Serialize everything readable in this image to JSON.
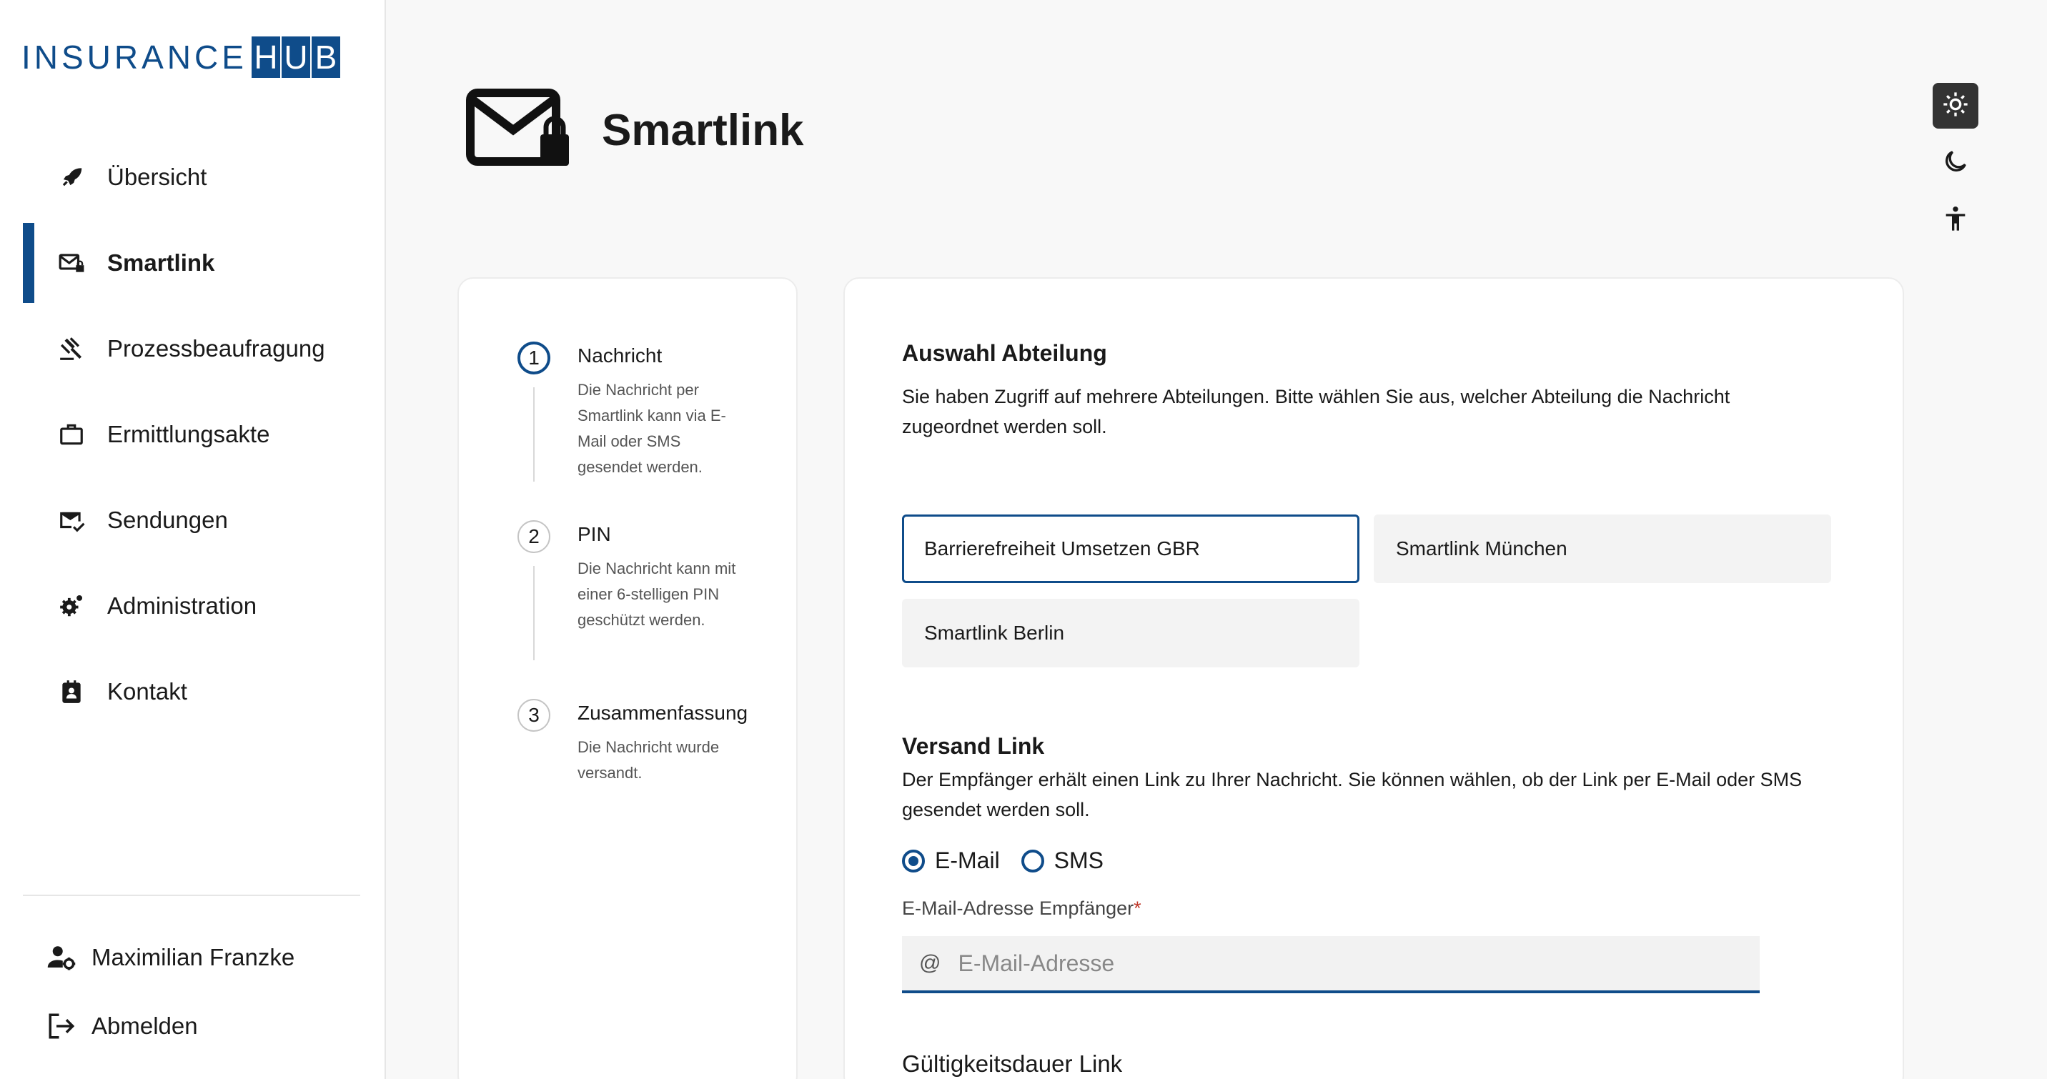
{
  "brand": {
    "logo_text_left": "INSURANCE",
    "logo_text_right": [
      "H",
      "U",
      "B"
    ],
    "accent_color": "#0f4c8a"
  },
  "sidebar": {
    "items": [
      {
        "label": "Übersicht",
        "icon": "rocket-icon"
      },
      {
        "label": "Smartlink",
        "icon": "mail-lock-icon",
        "active": true
      },
      {
        "label": "Prozessbeaufragung",
        "icon": "gavel-icon"
      },
      {
        "label": "Ermittlungsakte",
        "icon": "briefcase-icon"
      },
      {
        "label": "Sendungen",
        "icon": "mail-check-icon"
      },
      {
        "label": "Administration",
        "icon": "gear-icon"
      },
      {
        "label": "Kontakt",
        "icon": "contact-card-icon"
      }
    ],
    "user_name": "Maximilian Franzke",
    "logout_label": "Abmelden"
  },
  "page": {
    "title": "Smartlink",
    "title_icon": "mail-lock-icon"
  },
  "toolbar": {
    "icons": [
      "sun-icon",
      "moon-icon",
      "accessibility-icon"
    ],
    "active_theme": "light"
  },
  "stepper": {
    "steps": [
      {
        "num": "1",
        "title": "Nachricht",
        "desc": "Die Nachricht per Smartlink kann via E-Mail oder SMS gesendet werden.",
        "active": true
      },
      {
        "num": "2",
        "title": "PIN",
        "desc": "Die Nachricht kann mit einer 6-stelligen PIN geschützt werden."
      },
      {
        "num": "3",
        "title": "Zusammenfassung",
        "desc": "Die Nachricht wurde versandt."
      }
    ]
  },
  "form": {
    "dept_heading": "Auswahl Abteilung",
    "dept_desc": "Sie haben Zugriff auf mehrere Abteilungen. Bitte wählen Sie aus, welcher Abteilung die Nachricht zugeordnet werden soll.",
    "departments": [
      {
        "label": "Barrierefreiheit Umsetzen GBR",
        "selected": true
      },
      {
        "label": "Smartlink München"
      },
      {
        "label": "Smartlink Berlin"
      }
    ],
    "send_heading": "Versand Link",
    "send_desc": "Der Empfänger erhält einen Link zu Ihrer Nachricht. Sie können wählen, ob der Link per E-Mail oder SMS gesendet werden soll.",
    "radio_options": [
      {
        "label": "E-Mail",
        "checked": true
      },
      {
        "label": "SMS",
        "checked": false
      }
    ],
    "email_label": "E-Mail-Adresse Empfänger",
    "email_required_mark": "*",
    "email_prefix": "@",
    "email_value": "",
    "email_placeholder": "E-Mail-Adresse",
    "validity_heading": "Gültigkeitsdauer Link"
  }
}
